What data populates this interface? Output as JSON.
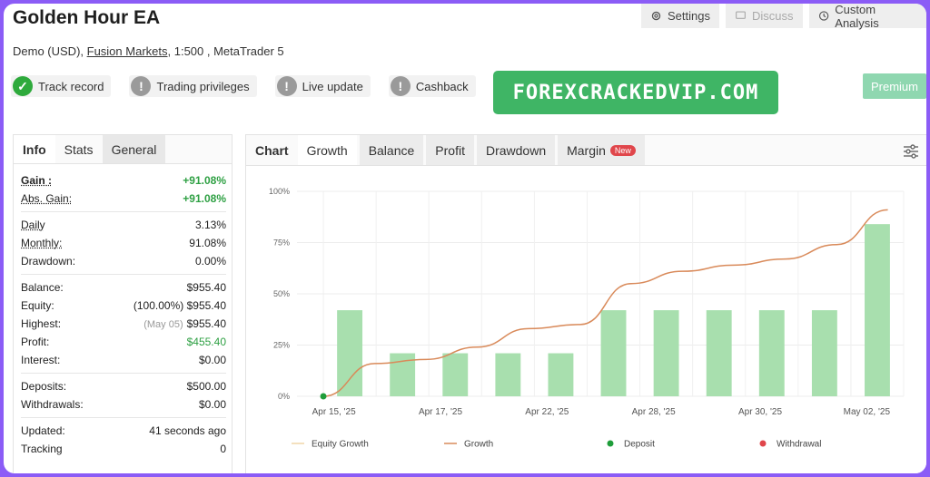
{
  "header": {
    "title": "Golden Hour EA",
    "subtitle_prefix": "Demo (USD), ",
    "broker": "Fusion Markets",
    "subtitle_suffix": ", 1:500 , MetaTrader 5",
    "settings_label": "Settings",
    "discuss_label": "Discuss",
    "custom_analysis_label": "Custom Analysis"
  },
  "badges": [
    {
      "label": "Track record",
      "icon": "check-icon",
      "status": "ok"
    },
    {
      "label": "Trading privileges",
      "icon": "exclamation-icon",
      "status": "warn"
    },
    {
      "label": "Live update",
      "icon": "exclamation-icon",
      "status": "warn"
    },
    {
      "label": "Cashback",
      "icon": "exclamation-icon",
      "status": "warn"
    }
  ],
  "watermark": "FOREXCRACKEDVIP.COM",
  "premium_label": "Premium",
  "left_tabs": [
    "Info",
    "Stats",
    "General"
  ],
  "stats": {
    "gain_label": "Gain :",
    "gain": "+91.08%",
    "abs_gain_label": "Abs. Gain:",
    "abs_gain": "+91.08%",
    "daily_label": "Daily",
    "daily": "3.13%",
    "monthly_label": "Monthly:",
    "monthly": "91.08%",
    "drawdown_label": "Drawdown:",
    "drawdown": "0.00%",
    "balance_label": "Balance:",
    "balance": "$955.40",
    "equity_label": "Equity:",
    "equity_pct": "(100.00%)",
    "equity": "$955.40",
    "highest_label": "Highest:",
    "highest_date": "(May 05)",
    "highest": "$955.40",
    "profit_label": "Profit:",
    "profit": "$455.40",
    "interest_label": "Interest:",
    "interest": "$0.00",
    "deposits_label": "Deposits:",
    "deposits": "$500.00",
    "withdrawals_label": "Withdrawals:",
    "withdrawals": "$0.00",
    "updated_label": "Updated:",
    "updated": "41 seconds ago",
    "tracking_label": "Tracking",
    "tracking": "0"
  },
  "chart_tabs": {
    "label": "Chart",
    "tabs": [
      "Growth",
      "Balance",
      "Profit",
      "Drawdown",
      "Margin"
    ],
    "new_badge": "New"
  },
  "colors": {
    "bar": "#a8dfae",
    "growth_line": "#d98a5a",
    "equity_line": "#f0d6a8",
    "deposit": "#1f9d3a",
    "withdrawal": "#e0464b"
  },
  "chart_data": {
    "type": "bar",
    "y_ticks": [
      "0%",
      "25%",
      "50%",
      "75%",
      "100%"
    ],
    "x_tick_labels": [
      "Apr 15, '25",
      "Apr 17, '25",
      "Apr 22, '25",
      "Apr 28, '25",
      "Apr 30, '25",
      "May 02, '25"
    ],
    "ylim": [
      0,
      100
    ],
    "bars": [
      42,
      21,
      21,
      21,
      21,
      42,
      42,
      42,
      42,
      42,
      84
    ],
    "growth_curve": [
      0,
      16,
      18,
      24,
      33,
      35,
      55,
      61,
      64,
      67,
      74,
      91
    ],
    "deposit_points": [
      0
    ],
    "legend": [
      "Equity Growth",
      "Growth",
      "Deposit",
      "Withdrawal"
    ],
    "legend_position": "bottom"
  }
}
